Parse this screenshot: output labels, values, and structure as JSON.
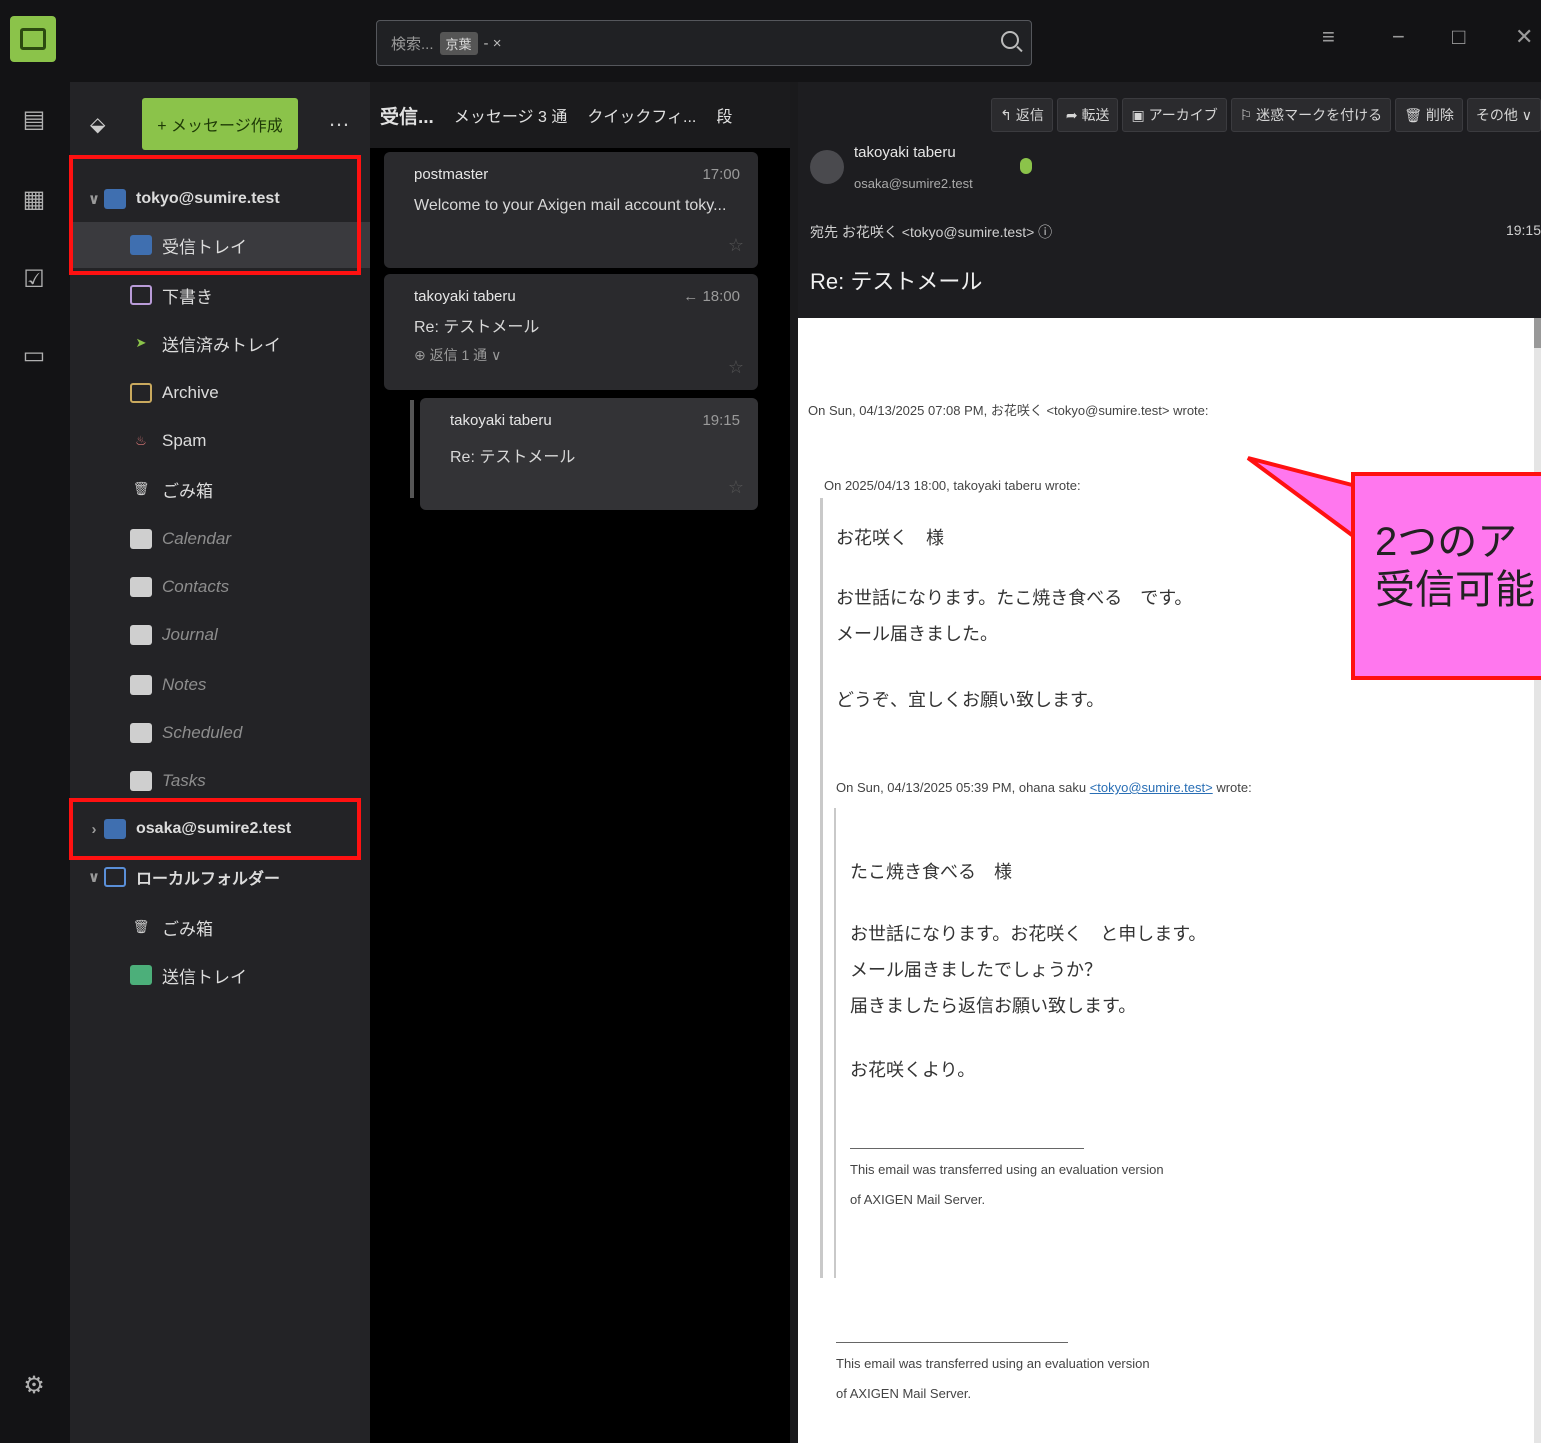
{
  "titlebar": {
    "search_placeholder": "検索...",
    "search_chip": "京葉",
    "search_chip2": "- ×"
  },
  "folder_pane": {
    "compose_label": "+ メッセージ作成",
    "accounts": [
      {
        "name": "tokyo@sumire.test",
        "expanded": true,
        "folders": [
          {
            "label": "受信トレイ",
            "selected": true
          },
          {
            "label": "下書き"
          },
          {
            "label": "送信済みトレイ"
          },
          {
            "label": "Archive"
          },
          {
            "label": "Spam"
          },
          {
            "label": "ごみ箱"
          },
          {
            "label": "Calendar"
          },
          {
            "label": "Contacts"
          },
          {
            "label": "Journal"
          },
          {
            "label": "Notes"
          },
          {
            "label": "Scheduled"
          },
          {
            "label": "Tasks"
          }
        ]
      },
      {
        "name": "osaka@sumire2.test",
        "expanded": false
      },
      {
        "name": "ローカルフォルダー",
        "expanded": true,
        "folders": [
          {
            "label": "ごみ箱"
          },
          {
            "label": "送信トレイ"
          }
        ]
      }
    ]
  },
  "message_list": {
    "folder_title": "受信...",
    "count_label": "メッセージ 3 通",
    "quick_filter": "クイックフィ...",
    "sort_label": "段",
    "messages": [
      {
        "from": "postmaster",
        "time": "17:00",
        "subject": "Welcome to your Axigen mail account toky..."
      },
      {
        "from": "takoyaki taberu",
        "time": "← 18:00",
        "subject": "Re: テストメール",
        "thread": "⊕ 返信 1 通 ∨"
      },
      {
        "from": "takoyaki taberu",
        "time": "19:15",
        "subject": "Re: テストメール"
      }
    ]
  },
  "reader": {
    "toolbar": [
      "↰ 返信",
      "➦ 転送",
      "▣ アーカイブ",
      "⚐ 迷惑マークを付ける",
      "🗑 削除",
      "その他 ∨"
    ],
    "sender_name": "takoyaki taberu",
    "sender_email": "osaka@sumire2.test",
    "to_line": "宛先 お花咲く <tokyo@sumire.test> ⓘ",
    "time": "19:15",
    "subject": "Re: テストメール",
    "body": {
      "l1": "On Sun, 04/13/2025 07:08 PM, お花咲く <tokyo@sumire.test> wrote:",
      "l2": "On 2025/04/13 18:00, takoyaki taberu wrote:",
      "l3": "お花咲く　様",
      "l4": "お世話になります。たこ焼き食べる　です。",
      "l5": "メール届きました。",
      "l6": "どうぞ、宜しくお願い致します。",
      "l7a": "On Sun, 04/13/2025 05:39 PM, ohana saku ",
      "l7b": "<tokyo@sumire.test>",
      "l7c": " wrote:",
      "l8": "たこ焼き食べる　様",
      "l9": "お世話になります。お花咲く　と申します。",
      "l10": "メール届きましたでしょうか？",
      "l11": "届きましたら返信お願い致します。",
      "l12": "お花咲くより。",
      "sig1": "This email was transferred using an evaluation version",
      "sig2": "of AXIGEN Mail Server.",
      "sig3": "This email was transferred using an evaluation version",
      "sig4": "of AXIGEN Mail Server."
    }
  },
  "callout": {
    "line1": "2つのア",
    "line2": "受信可能"
  },
  "colors": {
    "accent": "#8bc34a",
    "highlight_border": "#ff1111",
    "callout_fill": "#ff77ee"
  }
}
